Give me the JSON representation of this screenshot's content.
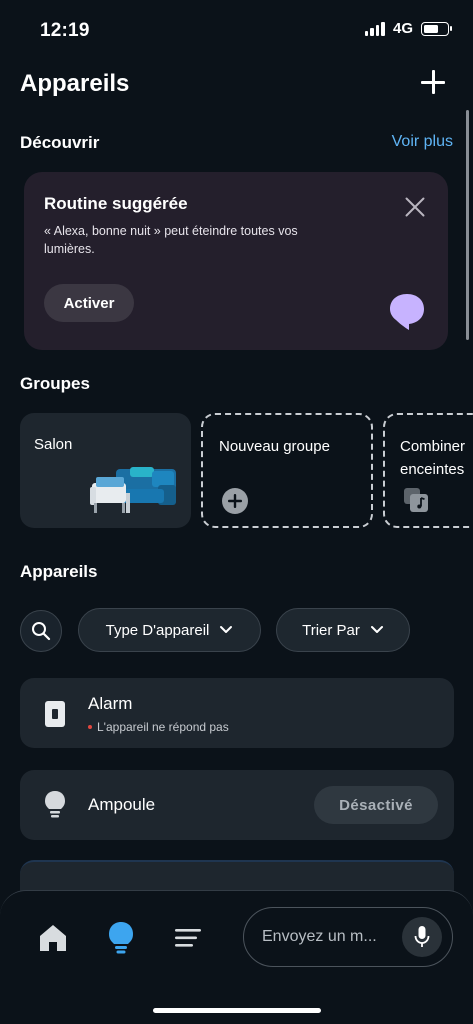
{
  "status_bar": {
    "time": "12:19",
    "network": "4G"
  },
  "header": {
    "title": "Appareils"
  },
  "discover": {
    "title": "Découvrir",
    "see_more": "Voir plus",
    "routine": {
      "title": "Routine suggérée",
      "description": "« Alexa, bonne nuit » peut éteindre toutes vos lumières.",
      "activate_label": "Activer",
      "icon": "speech-bubble-icon",
      "icon_color": "#c7b3ff"
    }
  },
  "groups": {
    "title": "Groupes",
    "items": [
      {
        "label": "Salon",
        "icon": "sofa-icon"
      },
      {
        "label": "Nouveau groupe",
        "icon": "plus-circle-icon"
      },
      {
        "label": "Combiner enceintes",
        "icon": "speaker-group-icon"
      }
    ]
  },
  "devices": {
    "title": "Appareils",
    "filters": [
      {
        "label": "Type D'appareil",
        "icon": "chevron-down-icon"
      },
      {
        "label": "Trier Par",
        "icon": "chevron-down-icon"
      }
    ],
    "items": [
      {
        "name": "Alarm",
        "status": "L'appareil ne répond pas",
        "icon": "switch-icon",
        "status_color": "#e0473f"
      },
      {
        "name": "Ampoule",
        "state": "Désactivé",
        "icon": "bulb-icon"
      }
    ]
  },
  "bottom_nav": {
    "items": [
      "home-icon",
      "devices-bulb-icon",
      "menu-icon"
    ],
    "active": "devices-bulb-icon",
    "accent": "#3da5ef",
    "message_placeholder": "Envoyez un m..."
  }
}
